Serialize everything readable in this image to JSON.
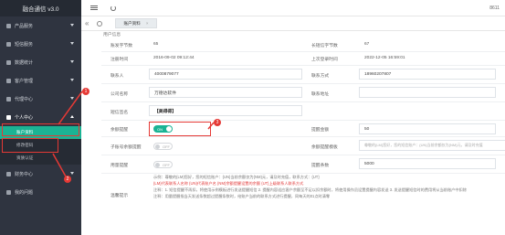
{
  "app": {
    "title": "融合通信 v3.0"
  },
  "sidebar": {
    "items": [
      {
        "label": "产品服务"
      },
      {
        "label": "短信服务"
      },
      {
        "label": "数据统计"
      },
      {
        "label": "客户管理"
      },
      {
        "label": "代理中心"
      },
      {
        "label": "个人中心"
      },
      {
        "label": "财务中心"
      },
      {
        "label": "我的问题"
      }
    ],
    "subitems": [
      {
        "label": "账户资料"
      },
      {
        "label": "修改密码"
      },
      {
        "label": "资质认证"
      }
    ]
  },
  "topbar": {
    "user": "8611"
  },
  "tabbar": {
    "tab_label": "账户资料",
    "close": "×"
  },
  "section": {
    "title": "用户信息"
  },
  "form": {
    "row1": {
      "l1": "账发字节数",
      "v1": "65",
      "l2": "长短信字节数",
      "v2": "67"
    },
    "row2": {
      "l1": "注册时间",
      "v1": "2016-09-02 09:12:44",
      "l2": "上次登录时间",
      "v2": "2022-12-05 16:59:01"
    },
    "row3": {
      "l1": "联系人",
      "v1": "4000879077",
      "l2": "联系方式",
      "v2": "18960207807"
    },
    "row4": {
      "l1": "公司名称",
      "v1": "万德达软件",
      "l2": "联系地址",
      "v2": ""
    },
    "row5": {
      "l1": "短信签名",
      "v1": "【美得得】"
    },
    "row6": {
      "l1": "余额提醒",
      "toggle": "ON",
      "l2": "提醒金额",
      "v2": "50"
    },
    "row7": {
      "l1": "子账号余额提醒",
      "toggle": "OFF",
      "l2": "余额提醒模板",
      "placeholder": "尊敬的{LM}您好，您的短信账户：{UN}当前余额仅为{NM}元，请及时充值"
    },
    "row8": {
      "l1": "用量提醒",
      "toggle": "OFF",
      "l2": "提醒条数",
      "v2": "5000"
    },
    "row9": {
      "l1": "温馨提示",
      "lines": [
        "示例：尊敬的{LM}您好，您的短信账户：{UN}当前余额仅为{NM}元，请及时充值，联系方式：{UT}",
        "{LM}代表联系人名称 {UN}代表账户名 {NM}余额提醒设置的余额 {UT}上级联系人联系方式",
        "注释：1. 短信提醒不再扣，将使用示例模板进行发送提醒短信 2. 提醒内容适应客户余额至不足以扣余额时，将使用操作员设置提醒内容发送 3. 发送提醒短信时的费用将从当前账户中扣除",
        "注释：用量提醒指当天发送条数超过提醒条数时，给账户当前的联系方式进行提醒，同每天的01点时清零"
      ]
    }
  },
  "annotations": {
    "n1": "1",
    "n2": "2",
    "n3": "3"
  },
  "colors": {
    "sidebar_bg": "#2f3440",
    "accent": "#1bb394",
    "annotation": "#e53935"
  }
}
